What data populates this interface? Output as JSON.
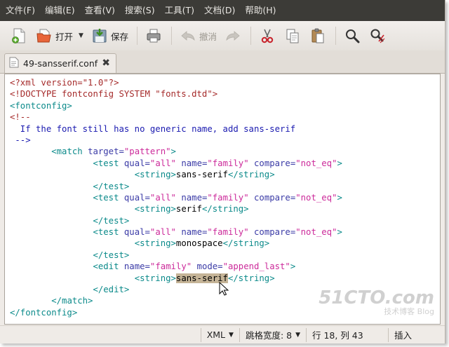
{
  "menubar": {
    "items": [
      "文件(F)",
      "编辑(E)",
      "查看(V)",
      "搜索(S)",
      "工具(T)",
      "文档(D)",
      "帮助(H)"
    ]
  },
  "toolbar": {
    "open_label": "打开",
    "save_label": "保存",
    "undo_label": "撤消"
  },
  "tab": {
    "filename": "49-sansserif.conf"
  },
  "editor": {
    "lines": [
      [
        {
          "t": "<?xml version=\"1.0\"?>",
          "c": "decl"
        }
      ],
      [
        {
          "t": "<!DOCTYPE fontconfig SYSTEM \"fonts.dtd\">",
          "c": "decl"
        }
      ],
      [
        {
          "t": "<fontconfig>",
          "c": "tag"
        }
      ],
      [
        {
          "t": "<!--",
          "c": "decl"
        }
      ],
      [
        {
          "t": "  If the font still has no generic name, add sans-serif",
          "c": "comm"
        }
      ],
      [
        {
          "t": " -->",
          "c": "comm"
        }
      ],
      [
        {
          "t": "        ",
          "c": "text"
        },
        {
          "t": "<match ",
          "c": "tag"
        },
        {
          "t": "target=",
          "c": "attr"
        },
        {
          "t": "\"pattern\"",
          "c": "val"
        },
        {
          "t": ">",
          "c": "tag"
        }
      ],
      [
        {
          "t": "                ",
          "c": "text"
        },
        {
          "t": "<test ",
          "c": "tag"
        },
        {
          "t": "qual=",
          "c": "attr"
        },
        {
          "t": "\"all\"",
          "c": "val"
        },
        {
          "t": " name=",
          "c": "attr"
        },
        {
          "t": "\"family\"",
          "c": "val"
        },
        {
          "t": " compare=",
          "c": "attr"
        },
        {
          "t": "\"not_eq\"",
          "c": "val"
        },
        {
          "t": ">",
          "c": "tag"
        }
      ],
      [
        {
          "t": "                        ",
          "c": "text"
        },
        {
          "t": "<string>",
          "c": "tag"
        },
        {
          "t": "sans-serif",
          "c": "text"
        },
        {
          "t": "</string>",
          "c": "tag"
        }
      ],
      [
        {
          "t": "                ",
          "c": "text"
        },
        {
          "t": "</test>",
          "c": "tag"
        }
      ],
      [
        {
          "t": "                ",
          "c": "text"
        },
        {
          "t": "<test ",
          "c": "tag"
        },
        {
          "t": "qual=",
          "c": "attr"
        },
        {
          "t": "\"all\"",
          "c": "val"
        },
        {
          "t": " name=",
          "c": "attr"
        },
        {
          "t": "\"family\"",
          "c": "val"
        },
        {
          "t": " compare=",
          "c": "attr"
        },
        {
          "t": "\"not_eq\"",
          "c": "val"
        },
        {
          "t": ">",
          "c": "tag"
        }
      ],
      [
        {
          "t": "                        ",
          "c": "text"
        },
        {
          "t": "<string>",
          "c": "tag"
        },
        {
          "t": "serif",
          "c": "text"
        },
        {
          "t": "</string>",
          "c": "tag"
        }
      ],
      [
        {
          "t": "                ",
          "c": "text"
        },
        {
          "t": "</test>",
          "c": "tag"
        }
      ],
      [
        {
          "t": "                ",
          "c": "text"
        },
        {
          "t": "<test ",
          "c": "tag"
        },
        {
          "t": "qual=",
          "c": "attr"
        },
        {
          "t": "\"all\"",
          "c": "val"
        },
        {
          "t": " name=",
          "c": "attr"
        },
        {
          "t": "\"family\"",
          "c": "val"
        },
        {
          "t": " compare=",
          "c": "attr"
        },
        {
          "t": "\"not_eq\"",
          "c": "val"
        },
        {
          "t": ">",
          "c": "tag"
        }
      ],
      [
        {
          "t": "                        ",
          "c": "text"
        },
        {
          "t": "<string>",
          "c": "tag"
        },
        {
          "t": "monospace",
          "c": "text"
        },
        {
          "t": "</string>",
          "c": "tag"
        }
      ],
      [
        {
          "t": "                ",
          "c": "text"
        },
        {
          "t": "</test>",
          "c": "tag"
        }
      ],
      [
        {
          "t": "                ",
          "c": "text"
        },
        {
          "t": "<edit ",
          "c": "tag"
        },
        {
          "t": "name=",
          "c": "attr"
        },
        {
          "t": "\"family\"",
          "c": "val"
        },
        {
          "t": " mode=",
          "c": "attr"
        },
        {
          "t": "\"append_last\"",
          "c": "val"
        },
        {
          "t": ">",
          "c": "tag"
        }
      ],
      [
        {
          "t": "                        ",
          "c": "text"
        },
        {
          "t": "<string>",
          "c": "tag"
        },
        {
          "t": "sans-serif",
          "c": "sel"
        },
        {
          "t": "</string>",
          "c": "tag"
        }
      ],
      [
        {
          "t": "                ",
          "c": "text"
        },
        {
          "t": "</edit>",
          "c": "tag"
        }
      ],
      [
        {
          "t": "        ",
          "c": "text"
        },
        {
          "t": "</match>",
          "c": "tag"
        }
      ],
      [
        {
          "t": "</fontconfig>",
          "c": "tag"
        }
      ]
    ]
  },
  "watermark": {
    "main": "51CTO.com",
    "sub": "技术博客  Blog"
  },
  "statusbar": {
    "language": "XML",
    "tab_width": "跳格宽度: 8",
    "position": "行 18, 列 43",
    "mode": "插入"
  },
  "colors": {
    "menubar_bg": "#3c3b37",
    "selection": "#c5b497",
    "tag": "#0b8a8a",
    "attr": "#3a3aa6",
    "value": "#cc2a9a",
    "comment": "#1a1ab0"
  }
}
